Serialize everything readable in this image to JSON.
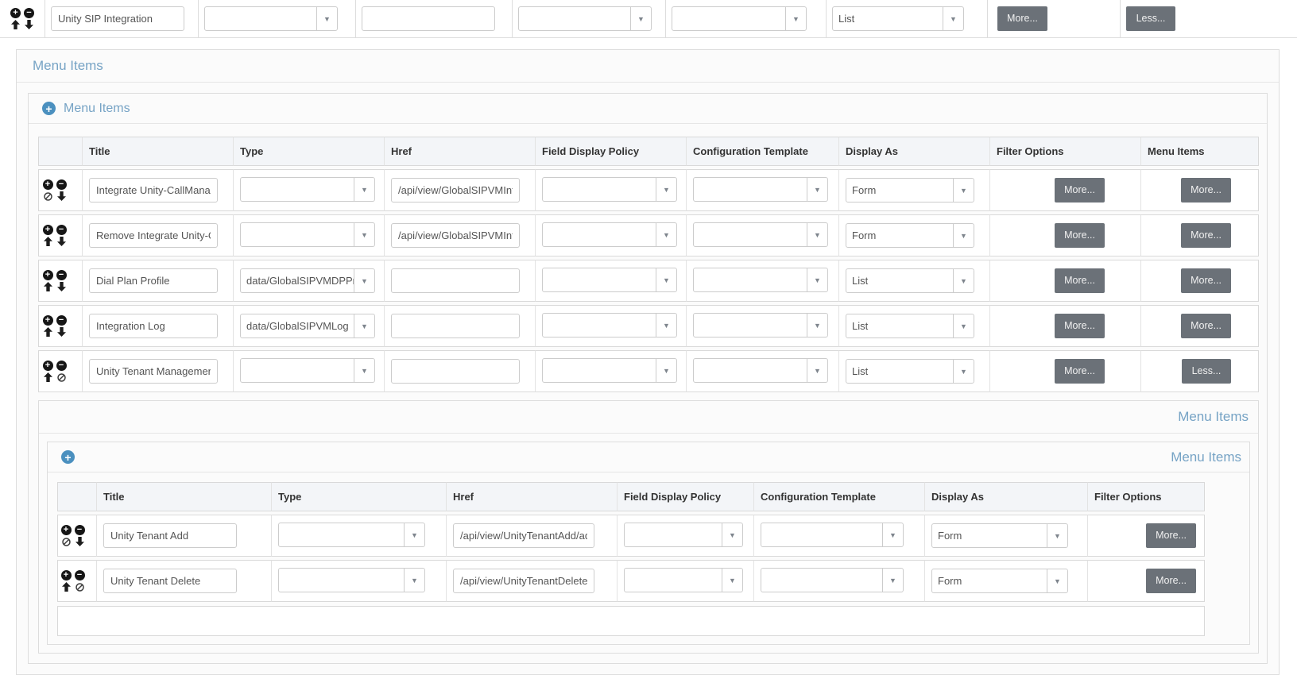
{
  "colors": {
    "accent_blue": "#76a3c5",
    "icon_blue": "#4b90bf",
    "button_gray": "#6b7178",
    "header_row_bg": "#f3f5f8"
  },
  "toolbar": {
    "title_value": "Unity SIP Integration",
    "type_value": "",
    "href_value": "",
    "field_display_policy_value": "",
    "configuration_template_value": "",
    "display_as_value": "List",
    "more_label": "More...",
    "less_label": "Less..."
  },
  "menu_items_panel": {
    "title": "Menu Items",
    "add_section_title": "Menu Items",
    "columns": [
      "Title",
      "Type",
      "Href",
      "Field Display Policy",
      "Configuration Template",
      "Display As",
      "Filter Options",
      "Menu Items"
    ],
    "rows": [
      {
        "title": "Integrate Unity-CallManag",
        "type": "",
        "href": "/api/view/GlobalSIPVMInte",
        "field_display_policy": "",
        "configuration_template": "",
        "display_as": "Form",
        "filter_options_label": "More...",
        "menu_items_label": "More..."
      },
      {
        "title": "Remove Integrate Unity-Ca",
        "type": "",
        "href": "/api/view/GlobalSIPVMInte",
        "field_display_policy": "",
        "configuration_template": "",
        "display_as": "Form",
        "filter_options_label": "More...",
        "menu_items_label": "More..."
      },
      {
        "title": "Dial Plan Profile",
        "type": "data/GlobalSIPVMDPPro",
        "href": "",
        "field_display_policy": "",
        "configuration_template": "",
        "display_as": "List",
        "filter_options_label": "More...",
        "menu_items_label": "More..."
      },
      {
        "title": "Integration Log",
        "type": "data/GlobalSIPVMLog",
        "href": "",
        "field_display_policy": "",
        "configuration_template": "",
        "display_as": "List",
        "filter_options_label": "More...",
        "menu_items_label": "More..."
      },
      {
        "title": "Unity Tenant Management",
        "type": "",
        "href": "",
        "field_display_policy": "",
        "configuration_template": "",
        "display_as": "List",
        "filter_options_label": "More...",
        "menu_items_label": "Less..."
      }
    ]
  },
  "nested_menu_items_panel": {
    "title": "Menu Items",
    "add_section_title": "Menu Items",
    "columns": [
      "Title",
      "Type",
      "Href",
      "Field Display Policy",
      "Configuration Template",
      "Display As",
      "Filter Options"
    ],
    "rows": [
      {
        "title": "Unity Tenant Add",
        "type": "",
        "href": "/api/view/UnityTenantAdd/ad",
        "field_display_policy": "",
        "configuration_template": "",
        "display_as": "Form",
        "filter_options_label": "More..."
      },
      {
        "title": "Unity Tenant Delete",
        "type": "",
        "href": "/api/view/UnityTenantDelete/",
        "field_display_policy": "",
        "configuration_template": "",
        "display_as": "Form",
        "filter_options_label": "More..."
      }
    ]
  }
}
